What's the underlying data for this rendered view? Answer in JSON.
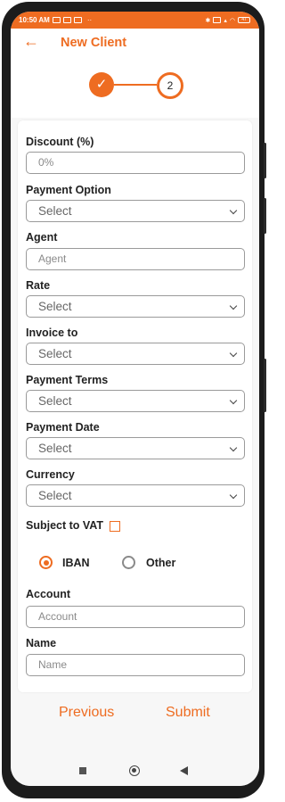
{
  "status_bar": {
    "time": "10:50 AM",
    "battery": "47"
  },
  "header": {
    "title": "New Client"
  },
  "stepper": {
    "step1_symbol": "✓",
    "step2_number": "2"
  },
  "form": {
    "discount": {
      "label": "Discount (%)",
      "placeholder": "0%"
    },
    "payment_option": {
      "label": "Payment Option",
      "value": "Select"
    },
    "agent": {
      "label": "Agent",
      "placeholder": "Agent"
    },
    "rate": {
      "label": "Rate",
      "value": "Select"
    },
    "invoice_to": {
      "label": "Invoice to",
      "value": "Select"
    },
    "payment_terms": {
      "label": "Payment Terms",
      "value": "Select"
    },
    "payment_date": {
      "label": "Payment Date",
      "value": "Select"
    },
    "currency": {
      "label": "Currency",
      "value": "Select"
    },
    "subject_to_vat": {
      "label": "Subject to VAT",
      "checked": false
    },
    "account_type": {
      "options": [
        "IBAN",
        "Other"
      ],
      "selected": "IBAN"
    },
    "account": {
      "label": "Account",
      "placeholder": "Account"
    },
    "name": {
      "label": "Name",
      "placeholder": "Name"
    }
  },
  "actions": {
    "previous_label": "Previous",
    "submit_label": "Submit"
  },
  "colors": {
    "accent": "#ee6c21"
  }
}
